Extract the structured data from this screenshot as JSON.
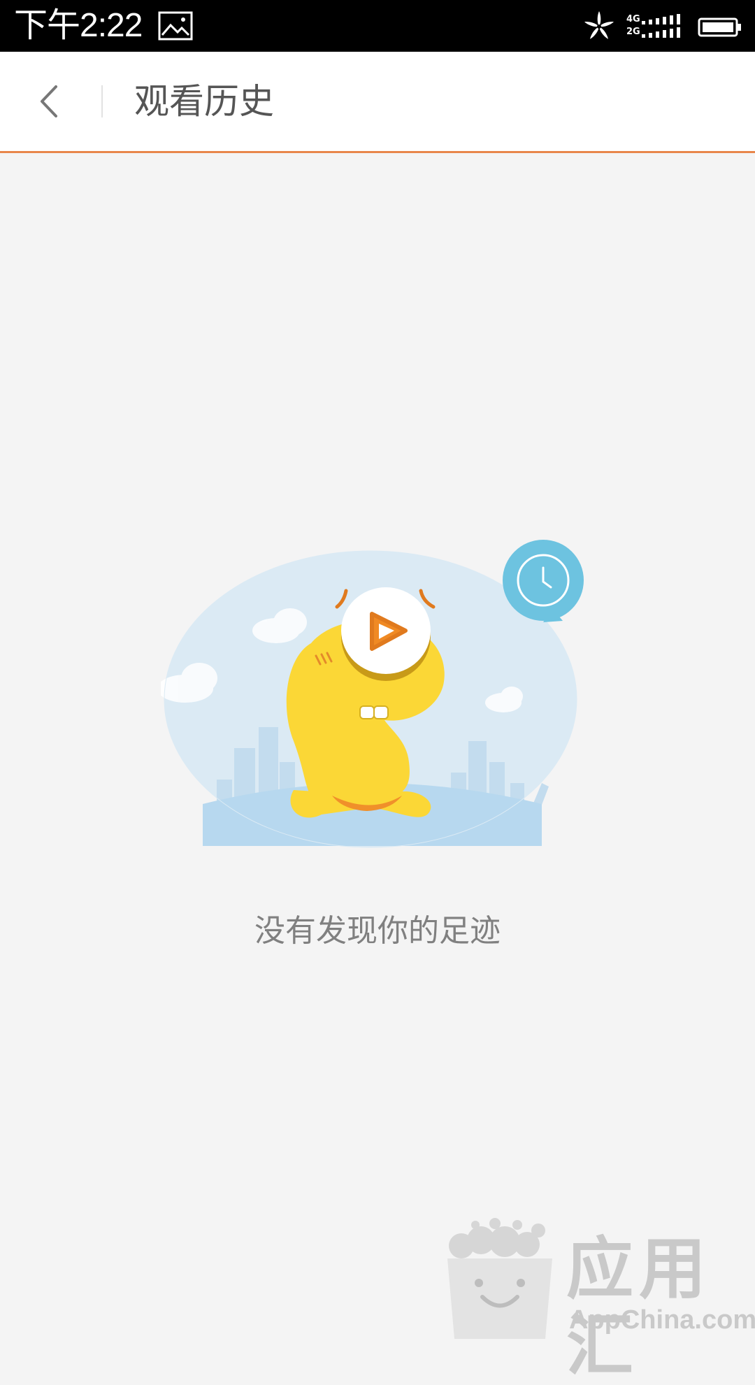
{
  "status_bar": {
    "time": "下午2:22",
    "network_top": "4G",
    "network_bottom": "2G",
    "icons": [
      "gallery-icon",
      "pinwheel-icon",
      "signal-icon",
      "battery-icon"
    ]
  },
  "app_bar": {
    "title": "观看历史",
    "back_icon": "chevron-left-icon",
    "accent_color": "#e8864a"
  },
  "empty_state": {
    "message": "没有发现你的足迹",
    "illustration": "yellow-mascot-with-play-logo-and-clock"
  },
  "watermark": {
    "title": "应用汇",
    "subtitle": "AppChina.com"
  }
}
